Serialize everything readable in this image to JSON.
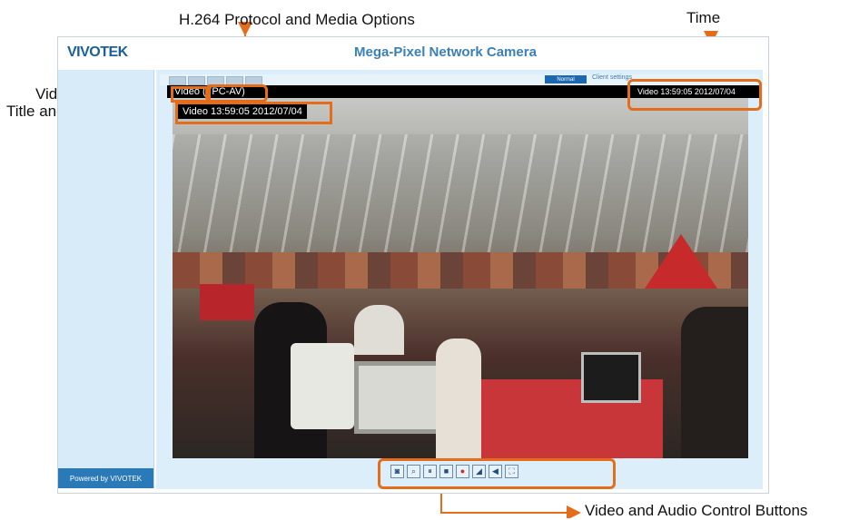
{
  "annotations": {
    "h264": "H.264 Protocol and Media Options",
    "time": "Time",
    "video_title": "Video Title",
    "title_and_time": "Title and Time",
    "controls": "Video and Audio Control Buttons"
  },
  "page": {
    "logo": "VIVOTEK",
    "title": "Mega-Pixel Network Camera",
    "powered_by": "Powered by VIVOTEK",
    "mode_button": "Normal",
    "mode_link": "Client settings"
  },
  "video": {
    "title": "Video",
    "protocol": "(TPC-AV)",
    "timestamp_title_time": "Video 13:59:05  2012/07/04",
    "timestamp_time": "Video 13:59:05  2012/07/04"
  },
  "controls": [
    {
      "name": "snapshot-icon",
      "glyph": "◙"
    },
    {
      "name": "digital-zoom-icon",
      "glyph": "⌕"
    },
    {
      "name": "pause-icon",
      "glyph": "⏸"
    },
    {
      "name": "stop-icon",
      "glyph": "■"
    },
    {
      "name": "record-icon",
      "glyph": "●"
    },
    {
      "name": "volume-icon",
      "glyph": "◢"
    },
    {
      "name": "talk-icon",
      "glyph": "◀"
    },
    {
      "name": "fullscreen-icon",
      "glyph": "⛶"
    }
  ],
  "colors": {
    "accent": "#e36d1b",
    "brand": "#1b5f99",
    "panel": "#dbeef9"
  }
}
